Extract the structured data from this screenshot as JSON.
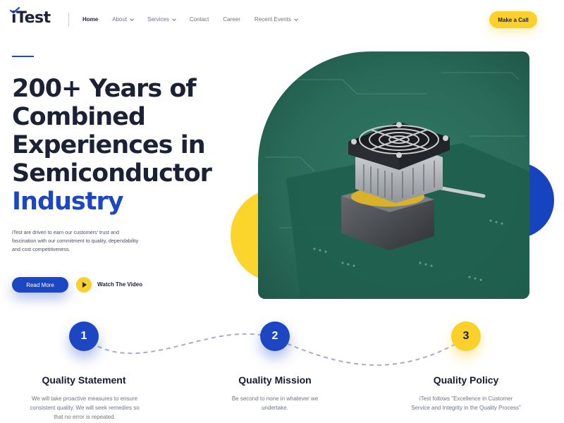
{
  "brand": {
    "logo_text": "iTest",
    "accent": "#1c46c2",
    "yellow": "#fbd02a"
  },
  "nav": {
    "items": [
      {
        "label": "Home",
        "active": true,
        "dropdown": false
      },
      {
        "label": "About",
        "active": false,
        "dropdown": true
      },
      {
        "label": "Services",
        "active": false,
        "dropdown": true
      },
      {
        "label": "Contact",
        "active": false,
        "dropdown": false
      },
      {
        "label": "Career",
        "active": false,
        "dropdown": false
      },
      {
        "label": "Recent Events",
        "active": false,
        "dropdown": true
      }
    ],
    "cta_label": "Make a Call"
  },
  "hero": {
    "title_lines": [
      "200+ Years of",
      "Combined",
      "Experiences in",
      "Semiconductor"
    ],
    "title_highlight": "Industry",
    "description": "iTest are driven to earn our customers' trust and fascination with our commitment to quality, dependability and cost competitiveness.",
    "read_more_label": "Read More",
    "watch_label": "Watch The Video"
  },
  "features": [
    {
      "number": "1",
      "title": "Quality Statement",
      "desc": "We will take proactive measures to ensure consistent quality. We will seek remedies so that no error is repeated.",
      "color": "blue"
    },
    {
      "number": "2",
      "title": "Quality Mission",
      "desc": "Be second to none in whatever we undertake.",
      "color": "blue"
    },
    {
      "number": "3",
      "title": "Quality Policy",
      "desc": "iTest follows \"Excellence in Customer Service and Integrity in the Quality Process\"",
      "color": "yellow"
    }
  ]
}
